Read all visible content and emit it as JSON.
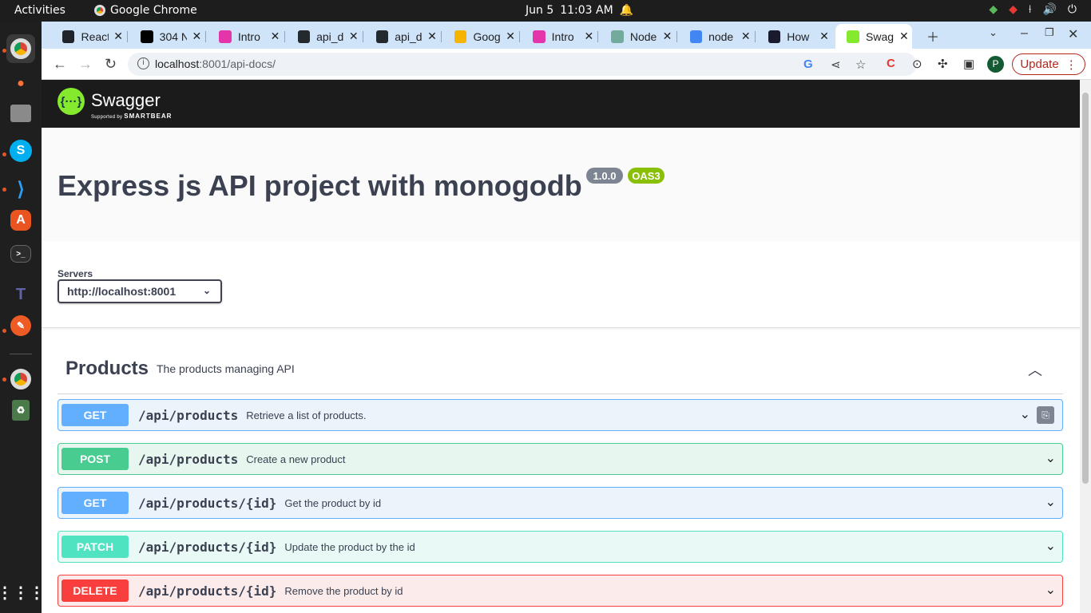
{
  "system_bar": {
    "activities": "Activities",
    "app_name": "Google Chrome",
    "date": "Jun 5",
    "time": "11:03 AM"
  },
  "browser": {
    "tabs": [
      {
        "title": "React",
        "icon": "react-icon",
        "icon_color": "#20232a"
      },
      {
        "title": "304 N",
        "icon": "medium-icon",
        "icon_color": "#000000"
      },
      {
        "title": "Intro",
        "icon": "graphql-icon",
        "icon_color": "#e535ab"
      },
      {
        "title": "api_d",
        "icon": "github-icon",
        "icon_color": "#24292e"
      },
      {
        "title": "api_d",
        "icon": "github-icon",
        "icon_color": "#24292e"
      },
      {
        "title": "Goog",
        "icon": "keep-icon",
        "icon_color": "#f4b400"
      },
      {
        "title": "Intro",
        "icon": "graphql-icon",
        "icon_color": "#e535ab"
      },
      {
        "title": "Node",
        "icon": "openai-icon",
        "icon_color": "#74aa9c"
      },
      {
        "title": "node",
        "icon": "docs-icon",
        "icon_color": "#4285f4"
      },
      {
        "title": "How",
        "icon": "app-icon",
        "icon_color": "#1a1a2e"
      },
      {
        "title": "Swag",
        "icon": "swagger-icon",
        "icon_color": "#85ea2d"
      }
    ],
    "active_tab_index": 10,
    "url_host": "localhost",
    "url_rest": ":8001/api-docs/",
    "update_label": "Update",
    "profile_initial": "P"
  },
  "swagger": {
    "brand": "Swagger",
    "supported_by": "Supported by",
    "smartbear": "SMARTBEAR",
    "api_title": "Express js API project with monogodb",
    "version": "1.0.0",
    "oas": "OAS3",
    "servers_label": "Servers",
    "server_value": "http://localhost:8001",
    "tag": {
      "name": "Products",
      "description": "The products managing API"
    },
    "operations": [
      {
        "method": "GET",
        "path": "/api/products",
        "summary": "Retrieve a list of products."
      },
      {
        "method": "POST",
        "path": "/api/products",
        "summary": "Create a new product"
      },
      {
        "method": "GET",
        "path": "/api/products/{id}",
        "summary": "Get the product by id"
      },
      {
        "method": "PATCH",
        "path": "/api/products/{id}",
        "summary": "Update the product by the id"
      },
      {
        "method": "DELETE",
        "path": "/api/products/{id}",
        "summary": "Remove the product by id"
      }
    ]
  }
}
